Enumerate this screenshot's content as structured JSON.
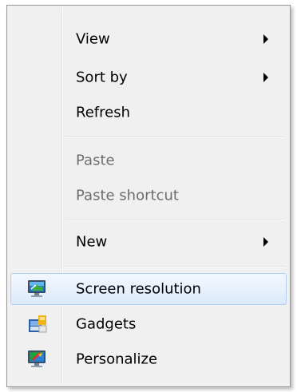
{
  "menu": {
    "items": [
      {
        "label": "View",
        "has_submenu": true,
        "disabled": false
      },
      {
        "label": "Sort by",
        "has_submenu": true,
        "disabled": false
      },
      {
        "label": "Refresh",
        "has_submenu": false,
        "disabled": false
      },
      {
        "label": "Paste",
        "has_submenu": false,
        "disabled": true
      },
      {
        "label": "Paste shortcut",
        "has_submenu": false,
        "disabled": true
      },
      {
        "label": "New",
        "has_submenu": true,
        "disabled": false
      },
      {
        "label": "Screen resolution",
        "has_submenu": false,
        "disabled": false,
        "icon": "screen-resolution-icon",
        "highlighted": true
      },
      {
        "label": "Gadgets",
        "has_submenu": false,
        "disabled": false,
        "icon": "gadgets-icon"
      },
      {
        "label": "Personalize",
        "has_submenu": false,
        "disabled": false,
        "icon": "personalize-icon"
      }
    ]
  },
  "colors": {
    "menu_background": "#f0f0f0",
    "highlight_border": "#aecff7",
    "disabled_text": "#6d6d6d"
  }
}
